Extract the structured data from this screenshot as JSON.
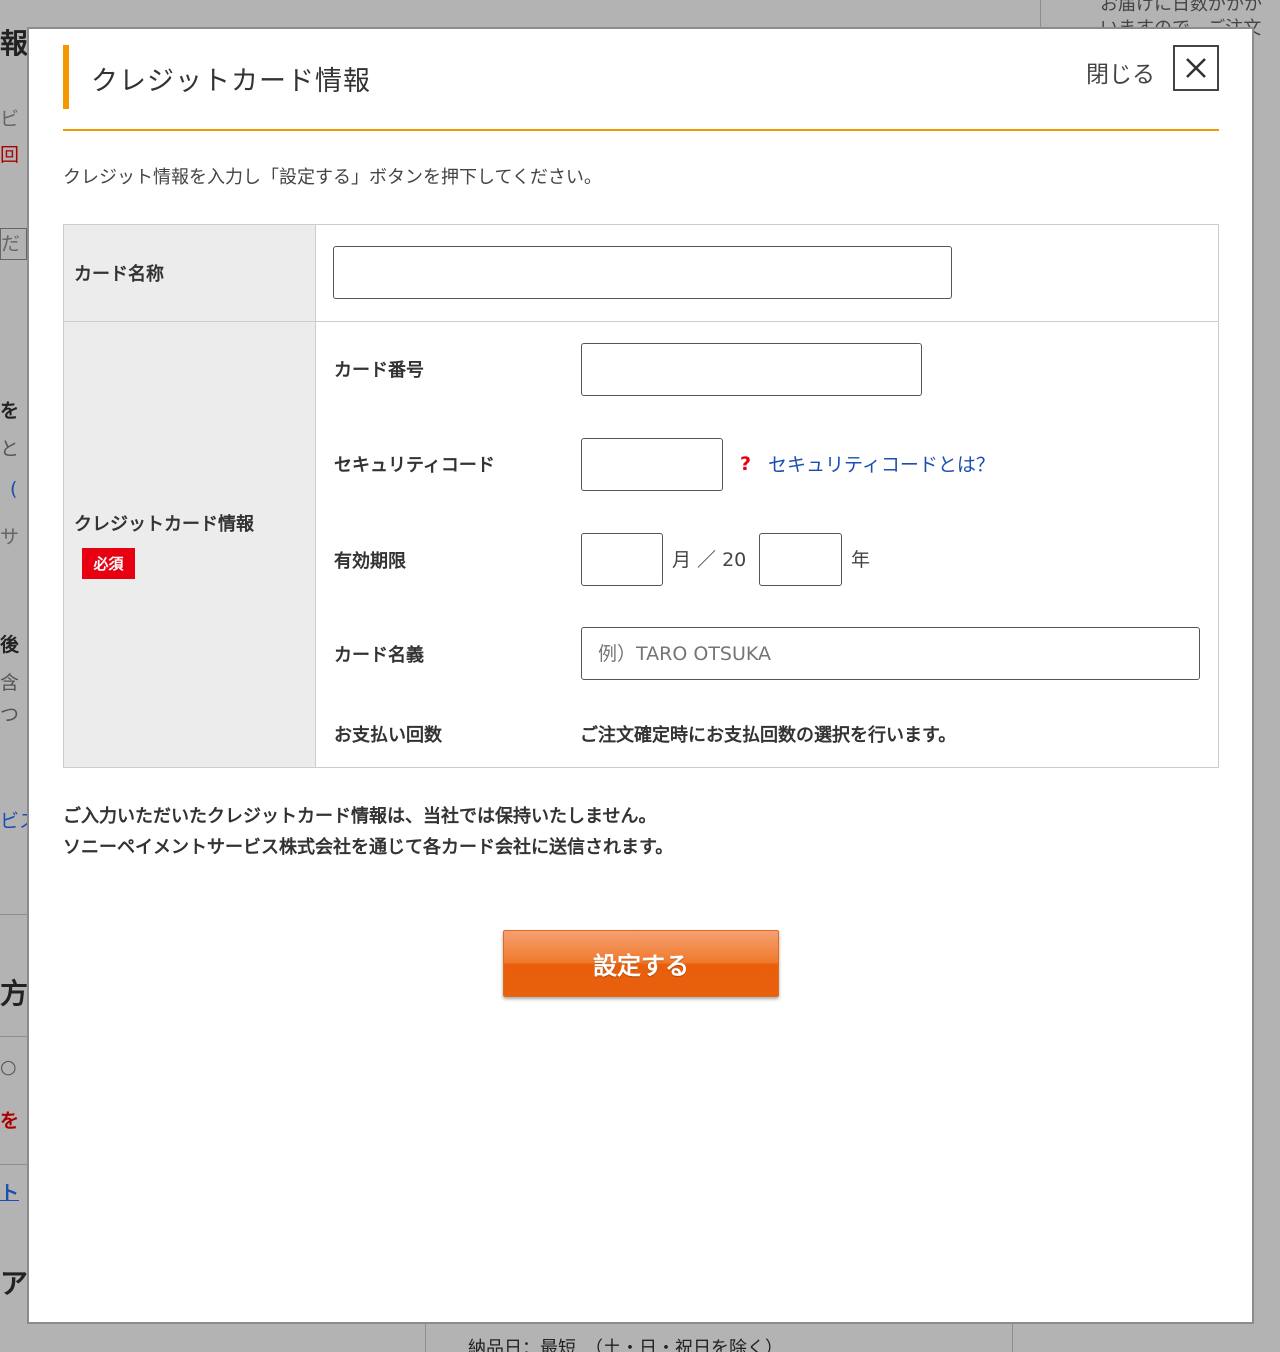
{
  "background": {
    "frag_top_right_1": "お届けに日数がかか",
    "frag_top_right_2": "いますので、ご注文",
    "frag_left_1": "報",
    "frag_left_2": "ビ",
    "frag_left_3": "回",
    "frag_left_4": "だ",
    "frag_left_5": "を",
    "frag_left_6": "と",
    "frag_left_7": "(",
    "frag_left_8": "サ",
    "frag_left_9": "後",
    "frag_left_10": "含",
    "frag_left_11": "つ",
    "frag_left_12": "ビス",
    "frag_left_13": "方",
    "frag_left_14": "○ ",
    "frag_left_15": "を",
    "frag_left_16": "ト",
    "frag_left_17": "ア",
    "frag_bottom": "納品日：最短　（土・日・祝日を除く）"
  },
  "modal": {
    "title": "クレジットカード情報",
    "close_label": "閉じる",
    "intro": "クレジット情報を入力し「設定する」ボタンを押下してください。",
    "rows": {
      "card_name_label": "カード名称",
      "credit_info_label": "クレジットカード情報",
      "required_badge": "必須",
      "card_number_label": "カード番号",
      "security_code_label": "セキュリティコード",
      "security_help_mark": "?",
      "security_help_link": "セキュリティコードとは？",
      "expiry_label": "有効期限",
      "expiry_month_unit": "月 ／ 20",
      "expiry_year_unit": "年",
      "holder_label": "カード名義",
      "holder_placeholder": "例）TARO OTSUKA",
      "installments_label": "お支払い回数",
      "installments_note": "ご注文確定時にお支払回数の選択を行います。"
    },
    "notice_line1": "ご入力いただいたクレジットカード情報は、当社では保持いたしません。",
    "notice_line2": "ソニーペイメントサービス株式会社を通じて各カード会社に送信されます。",
    "submit_label": "設定する"
  },
  "colors": {
    "accent": "#f39800",
    "required": "#e60012",
    "link": "#1a4fb0",
    "submit": "#ec6a1c"
  }
}
